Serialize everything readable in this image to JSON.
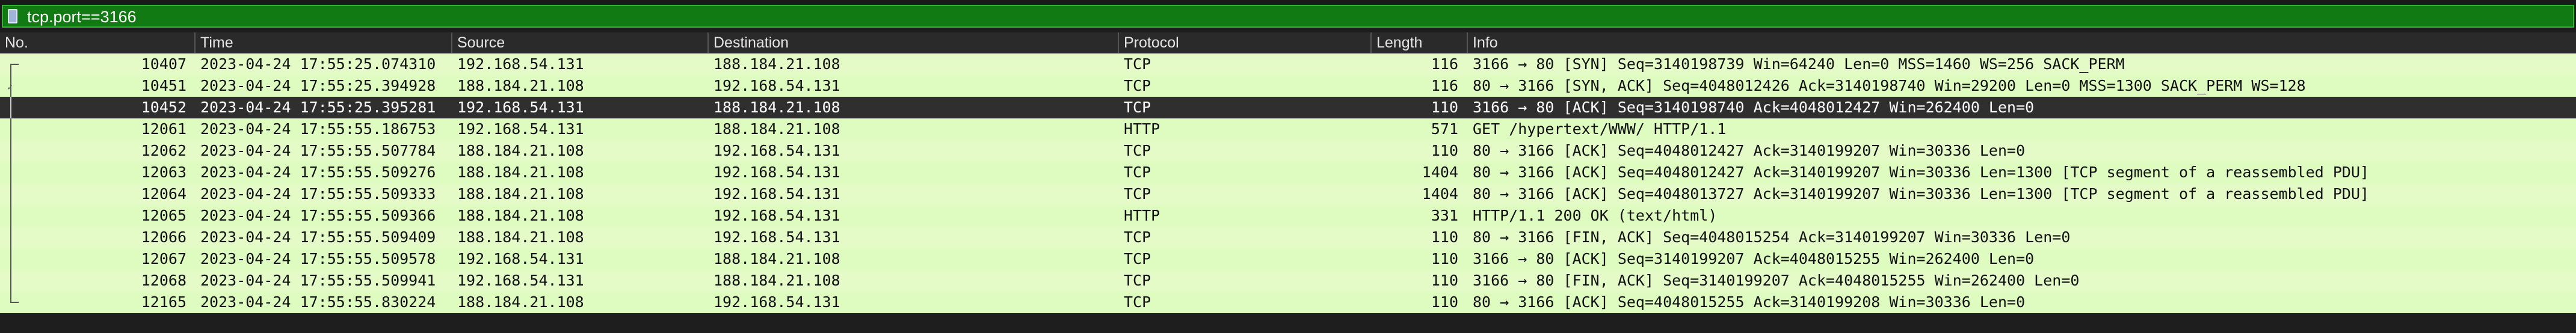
{
  "filter": {
    "value": "tcp.port==3166"
  },
  "columns": {
    "no": "No.",
    "time": "Time",
    "source": "Source",
    "destination": "Destination",
    "protocol": "Protocol",
    "length": "Length",
    "info": "Info"
  },
  "packets": [
    {
      "no": "10407",
      "time": "2023-04-24 17:55:25.074310",
      "src": "192.168.54.131",
      "dst": "188.184.21.108",
      "proto": "TCP",
      "len": "116",
      "info": "3166 → 80 [SYN] Seq=3140198739 Win=64240 Len=0 MSS=1460 WS=256 SACK_PERM"
    },
    {
      "no": "10451",
      "time": "2023-04-24 17:55:25.394928",
      "src": "188.184.21.108",
      "dst": "192.168.54.131",
      "proto": "TCP",
      "len": "116",
      "info": "80 → 3166 [SYN, ACK] Seq=4048012426 Ack=3140198740 Win=29200 Len=0 MSS=1300 SACK_PERM WS=128"
    },
    {
      "no": "10452",
      "time": "2023-04-24 17:55:25.395281",
      "src": "192.168.54.131",
      "dst": "188.184.21.108",
      "proto": "TCP",
      "len": "110",
      "info": "3166 → 80 [ACK] Seq=3140198740 Ack=4048012427 Win=262400 Len=0"
    },
    {
      "no": "12061",
      "time": "2023-04-24 17:55:55.186753",
      "src": "192.168.54.131",
      "dst": "188.184.21.108",
      "proto": "HTTP",
      "len": "571",
      "info": "GET /hypertext/WWW/ HTTP/1.1"
    },
    {
      "no": "12062",
      "time": "2023-04-24 17:55:55.507784",
      "src": "188.184.21.108",
      "dst": "192.168.54.131",
      "proto": "TCP",
      "len": "110",
      "info": "80 → 3166 [ACK] Seq=4048012427 Ack=3140199207 Win=30336 Len=0"
    },
    {
      "no": "12063",
      "time": "2023-04-24 17:55:55.509276",
      "src": "188.184.21.108",
      "dst": "192.168.54.131",
      "proto": "TCP",
      "len": "1404",
      "info": "80 → 3166 [ACK] Seq=4048012427 Ack=3140199207 Win=30336 Len=1300 [TCP segment of a reassembled PDU]"
    },
    {
      "no": "12064",
      "time": "2023-04-24 17:55:55.509333",
      "src": "188.184.21.108",
      "dst": "192.168.54.131",
      "proto": "TCP",
      "len": "1404",
      "info": "80 → 3166 [ACK] Seq=4048013727 Ack=3140199207 Win=30336 Len=1300 [TCP segment of a reassembled PDU]"
    },
    {
      "no": "12065",
      "time": "2023-04-24 17:55:55.509366",
      "src": "188.184.21.108",
      "dst": "192.168.54.131",
      "proto": "HTTP",
      "len": "331",
      "info": "HTTP/1.1 200 OK  (text/html)"
    },
    {
      "no": "12066",
      "time": "2023-04-24 17:55:55.509409",
      "src": "188.184.21.108",
      "dst": "192.168.54.131",
      "proto": "TCP",
      "len": "110",
      "info": "80 → 3166 [FIN, ACK] Seq=4048015254 Ack=3140199207 Win=30336 Len=0"
    },
    {
      "no": "12067",
      "time": "2023-04-24 17:55:55.509578",
      "src": "192.168.54.131",
      "dst": "188.184.21.108",
      "proto": "TCP",
      "len": "110",
      "info": "3166 → 80 [ACK] Seq=3140199207 Ack=4048015255 Win=262400 Len=0"
    },
    {
      "no": "12068",
      "time": "2023-04-24 17:55:55.509941",
      "src": "192.168.54.131",
      "dst": "188.184.21.108",
      "proto": "TCP",
      "len": "110",
      "info": "3166 → 80 [FIN, ACK] Seq=3140199207 Ack=4048015255 Win=262400 Len=0"
    },
    {
      "no": "12165",
      "time": "2023-04-24 17:55:55.830224",
      "src": "188.184.21.108",
      "dst": "192.168.54.131",
      "proto": "TCP",
      "len": "110",
      "info": "80 → 3166 [ACK] Seq=4048015255 Ack=3140199208 Win=30336 Len=0"
    }
  ],
  "colors": {
    "row_bg": "#e4fbc8",
    "selected_bg": "#2f2f2f",
    "filter_bg": "#127a12"
  }
}
